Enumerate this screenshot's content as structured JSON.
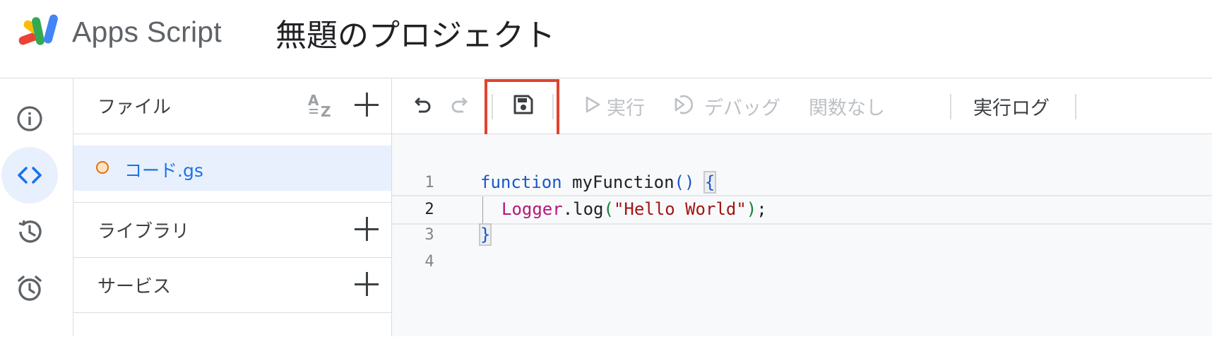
{
  "app": {
    "brand": "Apps Script",
    "project_title": "無題のプロジェクト"
  },
  "rail": {
    "items": [
      {
        "name": "overview",
        "icon": "info-icon"
      },
      {
        "name": "editor",
        "icon": "code-icon",
        "active": true
      },
      {
        "name": "history",
        "icon": "history-icon"
      },
      {
        "name": "triggers",
        "icon": "alarm-clock-icon"
      }
    ]
  },
  "files_panel": {
    "header_label": "ファイル",
    "sort_icon": "sort-az-icon",
    "add_icon": "plus-icon",
    "files": [
      {
        "name": "コード.gs",
        "status_color": "#e8710a"
      }
    ],
    "sections": [
      {
        "label": "ライブラリ"
      },
      {
        "label": "サービス"
      }
    ]
  },
  "toolbar": {
    "undo_icon": "undo-icon",
    "redo_icon": "redo-icon",
    "save_icon": "save-icon",
    "run_label": "実行",
    "debug_label": "デバッグ",
    "function_select": "関数なし",
    "execution_log_label": "実行ログ"
  },
  "editor": {
    "line_numbers": [
      "1",
      "2",
      "3",
      "4"
    ],
    "active_line": "2",
    "code": {
      "l1_keyword": "function",
      "l1_name": "myFunction",
      "l1_parens": "()",
      "l1_brace": "{",
      "l2_object": "Logger",
      "l2_method": ".log",
      "l2_open": "(",
      "l2_string": "\"Hello World\"",
      "l2_close": ")",
      "l2_end": ";",
      "l3_brace": "}"
    }
  },
  "colors": {
    "accent": "#1a73e8",
    "highlight_box": "#e0432d",
    "active_bg": "#e8f0fe"
  }
}
